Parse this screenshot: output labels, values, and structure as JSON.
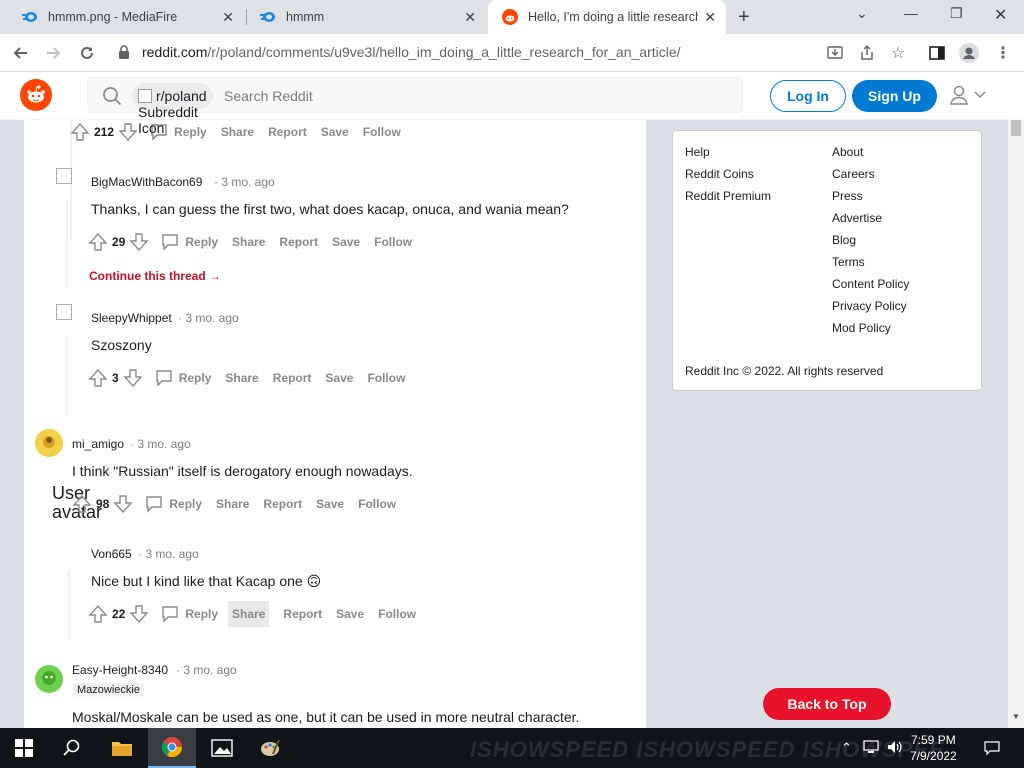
{
  "browser": {
    "tabs": [
      {
        "title": "hmmm.png - MediaFire",
        "active": false
      },
      {
        "title": "hmmm",
        "active": false
      },
      {
        "title": "Hello, I'm doing a little research f",
        "active": true
      }
    ],
    "url_host": "reddit.com",
    "url_path": "/r/poland/comments/u9ve3l/hello_im_doing_a_little_research_for_an_article/"
  },
  "header": {
    "community_chip": "r/poland",
    "subreddit_icon_alt": "Subreddit Icon",
    "search_placeholder": "Search Reddit",
    "login": "Log In",
    "signup": "Sign Up"
  },
  "comments": [
    {
      "id": "top",
      "votes": "212",
      "actions": [
        "Reply",
        "Share",
        "Report",
        "Save",
        "Follow"
      ]
    },
    {
      "id": "c1",
      "author": "BigMacWithBacon69",
      "meta": "· 3 mo. ago",
      "body": "Thanks, I can guess the first two, what does kacap, onuca, and wania mean?",
      "votes": "29",
      "actions": [
        "Reply",
        "Share",
        "Report",
        "Save",
        "Follow"
      ],
      "continue": "Continue this thread"
    },
    {
      "id": "c2",
      "author": "SleepyWhippet",
      "meta": "· 3 mo. ago",
      "body": "Szoszony",
      "votes": "3",
      "actions": [
        "Reply",
        "Share",
        "Report",
        "Save",
        "Follow"
      ]
    },
    {
      "id": "c3",
      "author": "mi_amigo",
      "meta": "· 3 mo. ago",
      "body": "I think \"Russian\" itself is derogatory enough nowadays.",
      "votes": "98",
      "actions": [
        "Reply",
        "Share",
        "Report",
        "Save",
        "Follow"
      ],
      "avatar_alt": "User avatar"
    },
    {
      "id": "c4",
      "author": "Von665",
      "meta": "· 3 mo. ago",
      "body": "Nice but I kind like that Kacap one 🙃",
      "votes": "22",
      "actions": [
        "Reply",
        "Share",
        "Report",
        "Save",
        "Follow"
      ]
    },
    {
      "id": "c5",
      "author": "Easy-Height-8340",
      "meta": "· 3 mo. ago",
      "flair": "Mazowieckie",
      "body": "Moskal/Moskale can be used as one, but it can be used in more neutral character."
    }
  ],
  "sidebar": {
    "col1": [
      "Help",
      "Reddit Coins",
      "Reddit Premium"
    ],
    "col2": [
      "About",
      "Careers",
      "Press",
      "Advertise",
      "Blog",
      "Terms",
      "Content Policy",
      "Privacy Policy",
      "Mod Policy"
    ],
    "copyright": "Reddit Inc © 2022. All rights reserved"
  },
  "back_to_top": "Back to Top",
  "taskbar": {
    "time": "7:59 PM",
    "date": "7/9/2022",
    "watermark": "ISHOWSPEED   ISHOWSPEED   ISHOWSPEE"
  }
}
